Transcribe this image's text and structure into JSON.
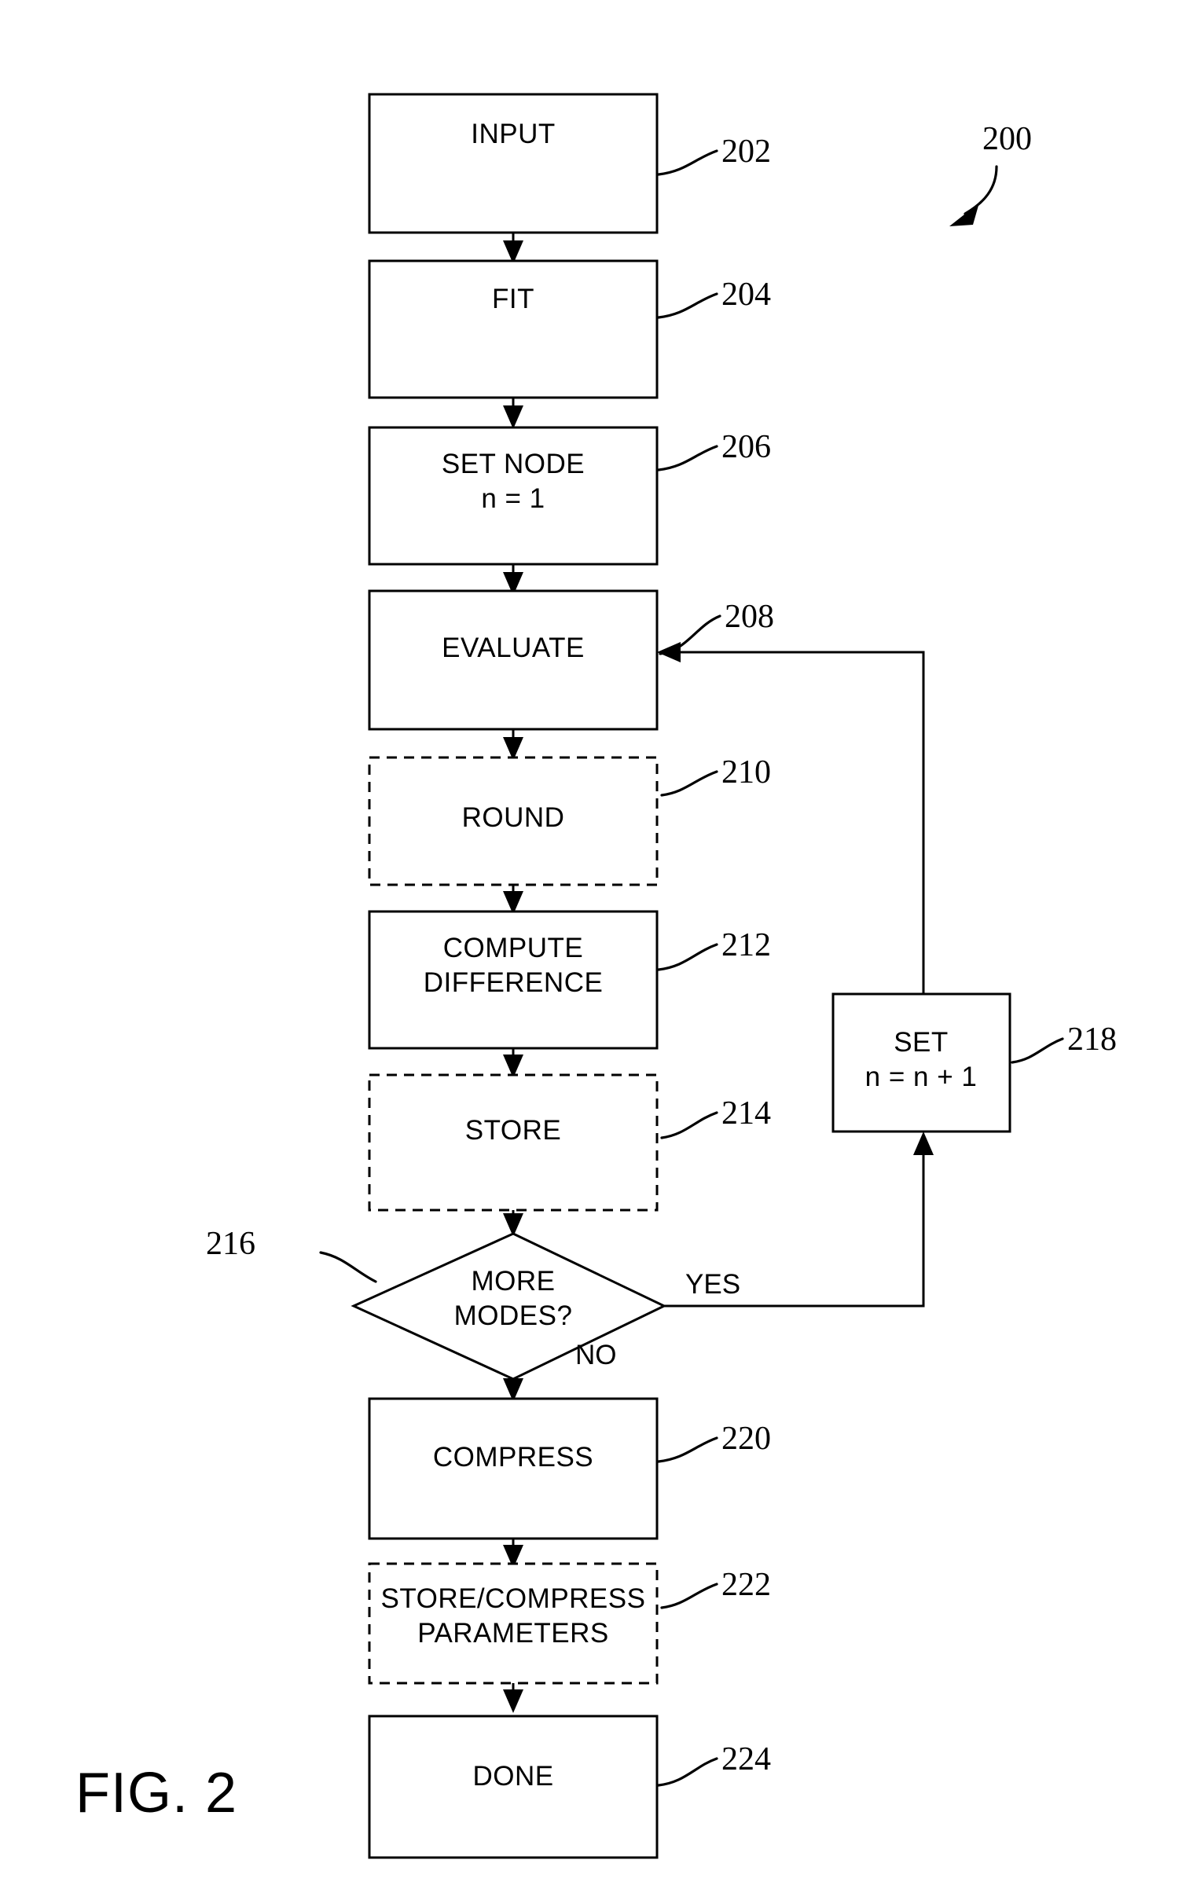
{
  "figure": {
    "caption": "FIG. 2",
    "diagram_ref": "200"
  },
  "nodes": [
    {
      "id": "input",
      "ref": "202",
      "lines": [
        "INPUT"
      ],
      "shape": "rect",
      "border": "solid"
    },
    {
      "id": "fit",
      "ref": "204",
      "lines": [
        "FIT"
      ],
      "shape": "rect",
      "border": "solid"
    },
    {
      "id": "set_node",
      "ref": "206",
      "lines": [
        "SET NODE",
        "n = 1"
      ],
      "shape": "rect",
      "border": "solid"
    },
    {
      "id": "evaluate",
      "ref": "208",
      "lines": [
        "EVALUATE"
      ],
      "shape": "rect",
      "border": "solid"
    },
    {
      "id": "round",
      "ref": "210",
      "lines": [
        "ROUND"
      ],
      "shape": "rect",
      "border": "dashed"
    },
    {
      "id": "compute",
      "ref": "212",
      "lines": [
        "COMPUTE",
        "DIFFERENCE"
      ],
      "shape": "rect",
      "border": "solid"
    },
    {
      "id": "store",
      "ref": "214",
      "lines": [
        "STORE"
      ],
      "shape": "rect",
      "border": "dashed"
    },
    {
      "id": "more",
      "ref": "216",
      "lines": [
        "MORE",
        "MODES?"
      ],
      "shape": "diamond",
      "border": "solid"
    },
    {
      "id": "set_incr",
      "ref": "218",
      "lines": [
        "SET",
        "n = n + 1"
      ],
      "shape": "rect",
      "border": "solid"
    },
    {
      "id": "compress",
      "ref": "220",
      "lines": [
        "COMPRESS"
      ],
      "shape": "rect",
      "border": "solid"
    },
    {
      "id": "params",
      "ref": "222",
      "lines": [
        "STORE/COMPRESS",
        "PARAMETERS"
      ],
      "shape": "rect",
      "border": "dashed"
    },
    {
      "id": "done",
      "ref": "224",
      "lines": [
        "DONE"
      ],
      "shape": "rect",
      "border": "solid"
    }
  ],
  "edge_labels": {
    "yes": "YES",
    "no": "NO"
  },
  "text": {
    "input": "INPUT",
    "fit": "FIT",
    "set_node_1": "SET NODE",
    "set_node_2": "n = 1",
    "evaluate": "EVALUATE",
    "round": "ROUND",
    "compute_1": "COMPUTE",
    "compute_2": "DIFFERENCE",
    "store": "STORE",
    "more_1": "MORE",
    "more_2": "MODES?",
    "set_incr_1": "SET",
    "set_incr_2": "n = n + 1",
    "compress": "COMPRESS",
    "params_1": "STORE/COMPRESS",
    "params_2": "PARAMETERS",
    "done": "DONE",
    "yes": "YES",
    "no": "NO",
    "ref_200": "200",
    "ref_202": "202",
    "ref_204": "204",
    "ref_206": "206",
    "ref_208": "208",
    "ref_210": "210",
    "ref_212": "212",
    "ref_214": "214",
    "ref_216": "216",
    "ref_218": "218",
    "ref_220": "220",
    "ref_222": "222",
    "ref_224": "224",
    "fig_caption": "FIG. 2"
  },
  "colors": {
    "ink": "#000000",
    "paper": "#ffffff"
  }
}
